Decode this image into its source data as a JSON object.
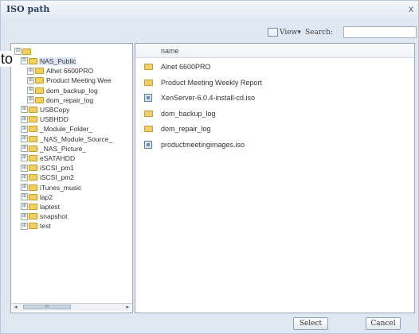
{
  "window": {
    "title": "ISO path",
    "close_glyph": "x"
  },
  "toolbar": {
    "view_label": "View▾",
    "search_label": "Search:",
    "search_value": ""
  },
  "tree": {
    "items": [
      {
        "label": "",
        "expander": "⊟",
        "level": 0,
        "selected": false
      },
      {
        "label": "NAS_Public",
        "expander": "⊟",
        "level": 1,
        "selected": true
      },
      {
        "label": "Alhet 6600PRO",
        "expander": "⊞",
        "level": 2,
        "selected": false
      },
      {
        "label": "Product Meeting Wee",
        "expander": "⊞",
        "level": 2,
        "selected": false
      },
      {
        "label": "dom_backup_log",
        "expander": "⊞",
        "level": 2,
        "selected": false
      },
      {
        "label": "dom_repair_log",
        "expander": "⊞",
        "level": 2,
        "selected": false
      },
      {
        "label": "USBCopy",
        "expander": "⊞",
        "level": 1,
        "selected": false
      },
      {
        "label": "USBHDD",
        "expander": "⊞",
        "level": 1,
        "selected": false
      },
      {
        "label": "_Module_Folder_",
        "expander": "⊞",
        "level": 1,
        "selected": false
      },
      {
        "label": "_NAS_Module_Source_",
        "expander": "⊞",
        "level": 1,
        "selected": false
      },
      {
        "label": "_NAS_Picture_",
        "expander": "⊞",
        "level": 1,
        "selected": false
      },
      {
        "label": "eSATAHDD",
        "expander": "⊞",
        "level": 1,
        "selected": false
      },
      {
        "label": "iSCSI_pm1",
        "expander": "⊞",
        "level": 1,
        "selected": false
      },
      {
        "label": "iSCSI_pm2",
        "expander": "⊞",
        "level": 1,
        "selected": false
      },
      {
        "label": "iTunes_music",
        "expander": "⊞",
        "level": 1,
        "selected": false
      },
      {
        "label": "lap2",
        "expander": "⊞",
        "level": 1,
        "selected": false
      },
      {
        "label": "laptest",
        "expander": "⊞",
        "level": 1,
        "selected": false
      },
      {
        "label": "snapshot",
        "expander": "⊞",
        "level": 1,
        "selected": false
      },
      {
        "label": "test",
        "expander": "⊞",
        "level": 1,
        "selected": false
      }
    ],
    "scroll_arrow_left": "◂",
    "scroll_arrow_right": "▸",
    "scroll_thumb_grip": "III"
  },
  "list": {
    "column_name": "name",
    "rows": [
      {
        "name": "Alnet 6600PRO",
        "icon": "folder-icon"
      },
      {
        "name": "Product Meeting Weekly Report",
        "icon": "folder-icon"
      },
      {
        "name": "XenServer-6.0.4-install-cd.iso",
        "icon": "iso-file-icon"
      },
      {
        "name": "dom_backup_log",
        "icon": "folder-icon"
      },
      {
        "name": "dom_repair_log",
        "icon": "folder-icon"
      },
      {
        "name": "productmeetingimages.iso",
        "icon": "iso-file-icon"
      }
    ]
  },
  "buttons": {
    "select": "Select",
    "cancel": "Cancel"
  },
  "overlay_text": "to"
}
